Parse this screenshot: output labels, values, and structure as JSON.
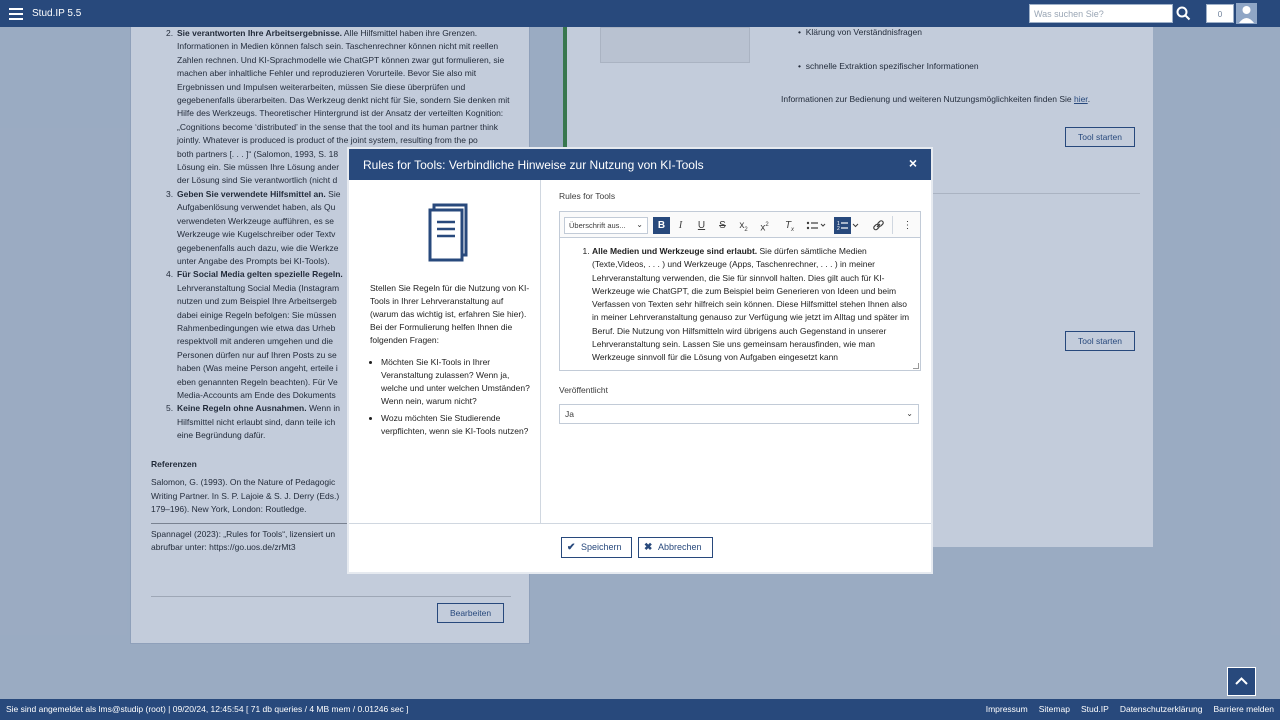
{
  "app": {
    "brand": "Stud.IP 5.5"
  },
  "topbar": {
    "search_placeholder": "Was suchen Sie?",
    "notification_count": "0"
  },
  "background": {
    "left_items": [
      {
        "strong": "Sie verantworten Ihre Arbeitsergebnisse.",
        "text": " Alle Hilfsmittel haben ihre Grenzen. Informationen in Medien können falsch sein. Taschenrechner können nicht mit reellen Zahlen rechnen. Und KI-Sprachmodelle wie ChatGPT können zwar gut formulieren, sie machen aber inhaltliche Fehler und reproduzieren Vorurteile. Bevor Sie also mit Ergebnissen und Impulsen weiterarbeiten, müssen Sie diese überprüfen und gegebenenfalls überarbeiten. Das Werkzeug denkt nicht für Sie, sondern Sie denken mit Hilfe des Werkzeugs. Theoretischer Hintergrund ist der Ansatz der verteilten Kognition: „Cognitions become ‘distributed’ in the sense that the tool and its human partner think jointly. Whatever is produced is product of the joint system, resulting from the po"
      },
      {
        "strong": "Geben Sie verwendete Hilfsmittel an.",
        "text": " Sie"
      },
      {
        "strong": "Für Social Media gelten spezielle Regeln.",
        "text": ""
      },
      {
        "strong": "Keine Regeln ohne Ausnahmen.",
        "text": " Wenn in"
      }
    ],
    "left_fragments": [
      "both partners [. . . ]“ (Salomon, 1993, S. 18",
      "Lösung ein. Sie müssen Ihre Lösung ander",
      "der Lösung sind Sie verantwortlich (nicht d",
      "Aufgabenlösung verwendet haben, als Qu",
      "verwendeten Werkzeuge aufführen, es se",
      "Werkzeuge wie Kugelschreiber oder Textv",
      "gegebenenfalls auch dazu, wie die Werkze",
      "unter Angabe des Prompts bei KI-Tools).",
      "Lehrveranstaltung Social Media (Instagram",
      "nutzen und zum Beispiel Ihre Arbeitsergeb",
      "dabei einige Regeln befolgen: Sie müssen",
      "Rahmenbedingungen wie etwa das Urheb",
      "respektvoll mit anderen umgehen und die",
      "Personen dürfen nur auf Ihren Posts zu se",
      "haben (Was meine Person angeht, erteile i",
      "eben genannten Regeln beachten). Für Ve",
      "Media-Accounts am Ende des Dokuments",
      "Hilfsmittel nicht erlaubt sind, dann teile ich",
      "eine Begründung dafür."
    ],
    "references_heading": "Referenzen",
    "reference_lines": [
      "Salomon, G. (1993). On the Nature of Pedagogic",
      "Writing Partner. In S. P. Lajoie & S. J. Derry (Eds.)",
      "179–196). New York, London: Routledge."
    ],
    "license_lines": [
      "Spannagel (2023): „Rules for Tools“, lizensiert un",
      "abrufbar unter: https://go.uos.de/zrMt3"
    ],
    "edit_button": "Bearbeiten",
    "right_bullets": [
      "Klärung von Verständnisfragen",
      "schnelle Extraktion spezifischer Informationen"
    ],
    "right_info": "Informationen zur Bedienung und weiteren Nutzungsmöglichkeiten finden Sie ",
    "right_info_link": "hier",
    "tool_button_1": "Tool starten",
    "tool_button_2": "Tool starten"
  },
  "dialog": {
    "title": "Rules for Tools: Verbindliche Hinweise zur Nutzung von KI-Tools",
    "close_label": "×",
    "intro": "Stellen Sie Regeln für die Nutzung von KI-Tools in Ihrer Lehrveranstaltung auf (warum das wichtig ist, erfahren Sie hier). Bei der Formulierung helfen Ihnen die folgenden Fragen:",
    "questions": [
      "Möchten Sie KI-Tools in Ihrer Veranstaltung zulassen? Wenn ja, welche und unter welchen Umständen? Wenn nein, warum nicht?",
      "Wozu möchten Sie Studierende verpflichten, wenn sie KI-Tools nutzen?"
    ],
    "editor_label": "Rules for Tools",
    "heading_select": "Überschrift aus...",
    "editor_item_strong": "Alle Medien und Werkzeuge sind erlaubt.",
    "editor_item_text": " Sie dürfen sämtliche Medien (Texte,Videos, . . . ) und Werkzeuge (Apps, Taschenrechner, . . . ) in meiner Lehrveranstaltung verwenden, die Sie für sinnvoll halten. Dies gilt auch für KI-Werkzeuge wie ChatGPT, die zum Beispiel beim Generieren von Ideen und beim Verfassen von Texten sehr hilfreich sein können. Diese Hilfsmittel stehen Ihnen also in meiner Lehrveranstaltung genauso zur Verfügung wie jetzt im Alltag und später im Beruf. Die Nutzung von Hilfsmitteln wird übrigens auch Gegenstand in unserer Lehrveranstaltung sein. Lassen Sie uns gemeinsam herausfinden, wie man Werkzeuge sinnvoll für die Lösung von Aufgaben eingesetzt kann",
    "published_label": "Veröffentlicht",
    "published_value": "Ja",
    "save_label": "Speichern",
    "cancel_label": "Abbrechen"
  },
  "footer": {
    "status": "Sie sind angemeldet als lms@studip (root) | 09/20/24, 12:45:54 [ 71 db queries / 4 MB mem / 0.01246 sec ]",
    "links": [
      "Impressum",
      "Sitemap",
      "Stud.IP",
      "Datenschutzerklärung",
      "Barriere melden"
    ]
  }
}
